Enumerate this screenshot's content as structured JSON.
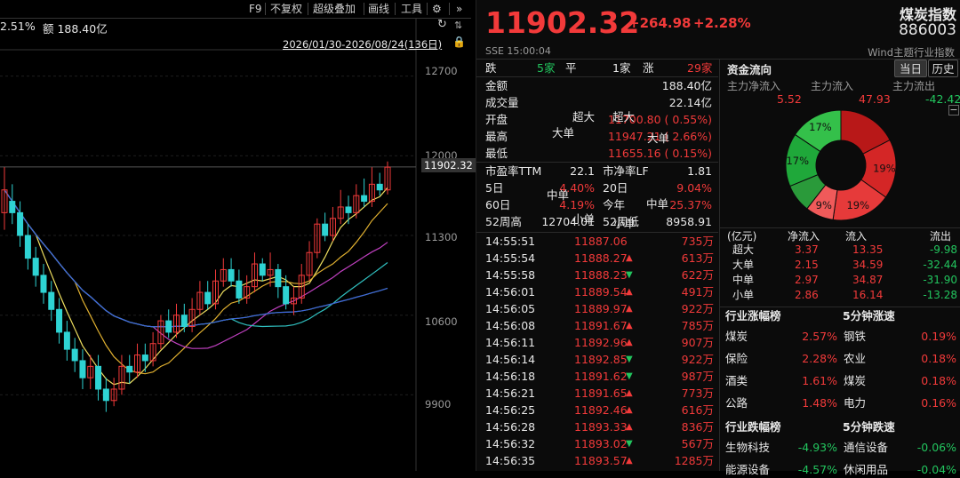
{
  "toolbar": {
    "f9": "F9",
    "no_adjust": "不复权",
    "overlay": "超级叠加",
    "draw": "画线",
    "tools": "工具",
    "expand": "»"
  },
  "chart_header": {
    "pct": "2.51%",
    "amount": "额 188.40亿",
    "range": "2026/01/30-2026/08/24(136日)"
  },
  "price_axis": {
    "labels": [
      "12700",
      "12000",
      "11300",
      "10600",
      "9900"
    ],
    "current": "11902.32"
  },
  "quote": {
    "price": "11902.32",
    "change": "+264.98",
    "change_pct": "+2.28%",
    "name": "煤炭指数",
    "code": "886003",
    "exchange_time": "SSE  15:00:04",
    "source": "Wind主题行业指数"
  },
  "breadth": {
    "down_label": "跌",
    "down": "5家",
    "flat_label": "平",
    "flat": "1家",
    "up_label": "涨",
    "up": "29家"
  },
  "stats": [
    {
      "label": "金额",
      "value": "188.40亿",
      "color": "white"
    },
    {
      "label": "成交量",
      "value": "22.14亿",
      "color": "white"
    },
    {
      "label": "开盘",
      "value": "11700.80 ( 0.55%)",
      "color": "red"
    },
    {
      "label": "最高",
      "value": "11947.21 ( 2.66%)",
      "color": "red"
    },
    {
      "label": "最低",
      "value": "11655.16 ( 0.15%)",
      "color": "red"
    }
  ],
  "metrics": [
    {
      "l1": "市盈率TTM",
      "v1": "22.1",
      "c1": "white",
      "l2": "市净率LF",
      "v2": "1.81",
      "c2": "white"
    },
    {
      "l1": "5日",
      "v1": "4.40%",
      "c1": "red",
      "l2": "20日",
      "v2": "9.04%",
      "c2": "red"
    },
    {
      "l1": "60日",
      "v1": "4.19%",
      "c1": "red",
      "l2": "今年",
      "v2": "25.37%",
      "c2": "red"
    },
    {
      "l1": "52周高",
      "v1": "12704.01",
      "c1": "white",
      "l2": "52周低",
      "v2": "8958.91",
      "c2": "white"
    }
  ],
  "ticks": [
    {
      "time": "14:55:51",
      "price": "11887.06",
      "dir": "",
      "vol": "735万"
    },
    {
      "time": "14:55:54",
      "price": "11888.27",
      "dir": "up",
      "vol": "613万"
    },
    {
      "time": "14:55:58",
      "price": "11888.23",
      "dir": "down",
      "vol": "622万"
    },
    {
      "time": "14:56:01",
      "price": "11889.54",
      "dir": "up",
      "vol": "491万"
    },
    {
      "time": "14:56:05",
      "price": "11889.97",
      "dir": "up",
      "vol": "922万"
    },
    {
      "time": "14:56:08",
      "price": "11891.67",
      "dir": "up",
      "vol": "785万"
    },
    {
      "time": "14:56:11",
      "price": "11892.96",
      "dir": "up",
      "vol": "907万"
    },
    {
      "time": "14:56:14",
      "price": "11892.85",
      "dir": "down",
      "vol": "922万"
    },
    {
      "time": "14:56:18",
      "price": "11891.62",
      "dir": "down",
      "vol": "987万"
    },
    {
      "time": "14:56:21",
      "price": "11891.65",
      "dir": "up",
      "vol": "773万"
    },
    {
      "time": "14:56:25",
      "price": "11892.46",
      "dir": "up",
      "vol": "616万"
    },
    {
      "time": "14:56:28",
      "price": "11893.33",
      "dir": "up",
      "vol": "836万"
    },
    {
      "time": "14:56:32",
      "price": "11893.02",
      "dir": "down",
      "vol": "567万"
    },
    {
      "time": "14:56:35",
      "price": "11893.57",
      "dir": "up",
      "vol": "1285万"
    }
  ],
  "fund_flow": {
    "title": "资金流向",
    "tab_today": "当日",
    "tab_history": "历史",
    "main_net_label": "主力净流入",
    "main_in_label": "主力流入",
    "main_out_label": "主力流出",
    "main_net": "5.52",
    "main_in": "47.93",
    "main_out": "-42.42",
    "donut": [
      {
        "name": "超大",
        "value": 19,
        "color": "#b81818",
        "label": ""
      },
      {
        "name": "大单",
        "value": 19,
        "color": "#d42626",
        "label": "19%"
      },
      {
        "name": "中单",
        "value": 19,
        "color": "#e63a3a",
        "label": "19%"
      },
      {
        "name": "小单",
        "value": 9,
        "color": "#f05a5a",
        "label": "9%"
      },
      {
        "name": "小单",
        "value": 9,
        "color": "#2a9a3a",
        "label": ""
      },
      {
        "name": "中单",
        "value": 17,
        "color": "#1fa83a",
        "label": "17%"
      },
      {
        "name": "大单",
        "value": 17,
        "color": "#34c04a",
        "label": "17%"
      }
    ],
    "donut_labels": [
      "超大",
      "超大",
      "大单",
      "大单",
      "中单",
      "中单",
      "小单",
      "小单"
    ],
    "table_head": [
      "(亿元)",
      "净流入",
      "流入",
      "流出"
    ],
    "table": [
      {
        "name": "超大",
        "net": "3.37",
        "in": "13.35",
        "out": "-9.98"
      },
      {
        "name": "大单",
        "net": "2.15",
        "in": "34.59",
        "out": "-32.44"
      },
      {
        "name": "中单",
        "net": "2.97",
        "in": "34.87",
        "out": "-31.90"
      },
      {
        "name": "小单",
        "net": "2.86",
        "in": "16.14",
        "out": "-13.28"
      }
    ]
  },
  "rankings": {
    "gain_title": "行业涨幅榜",
    "speed_up_title": "5分钟涨速",
    "gains": [
      {
        "n": "煤炭",
        "v": "2.57%"
      },
      {
        "n": "保险",
        "v": "2.28%"
      },
      {
        "n": "酒类",
        "v": "1.61%"
      },
      {
        "n": "公路",
        "v": "1.48%"
      }
    ],
    "speed_up": [
      {
        "n": "钢铁",
        "v": "0.19%"
      },
      {
        "n": "农业",
        "v": "0.18%"
      },
      {
        "n": "煤炭",
        "v": "0.18%"
      },
      {
        "n": "电力",
        "v": "0.16%"
      }
    ],
    "loss_title": "行业跌幅榜",
    "speed_dn_title": "5分钟跌速",
    "losses": [
      {
        "n": "生物科技",
        "v": "-4.93%"
      },
      {
        "n": "能源设备",
        "v": "-4.57%"
      }
    ],
    "speed_dn": [
      {
        "n": "通信设备",
        "v": "-0.06%"
      },
      {
        "n": "休闲用品",
        "v": "-0.04%"
      }
    ]
  },
  "chart_data": {
    "type": "candlestick",
    "ylim": [
      9700,
      12900
    ],
    "yticks": [
      12700,
      12000,
      11300,
      10600,
      9900
    ],
    "candles": [
      [
        11500,
        11700,
        11900,
        11350
      ],
      [
        11600,
        11500,
        11750,
        11400
      ],
      [
        11500,
        11300,
        11600,
        11200
      ],
      [
        11300,
        11100,
        11400,
        11000
      ],
      [
        11100,
        10950,
        11200,
        10850
      ],
      [
        10950,
        10800,
        11050,
        10700
      ],
      [
        10800,
        10650,
        10900,
        10550
      ],
      [
        10650,
        10450,
        10750,
        10350
      ],
      [
        10450,
        10300,
        10550,
        10200
      ],
      [
        10300,
        10200,
        10400,
        10100
      ],
      [
        10200,
        10050,
        10300,
        9950
      ],
      [
        10050,
        10150,
        10250,
        9950
      ],
      [
        10150,
        9950,
        10250,
        9850
      ],
      [
        9950,
        9850,
        10050,
        9750
      ],
      [
        9850,
        9950,
        10050,
        9800
      ],
      [
        9950,
        10150,
        10250,
        9900
      ],
      [
        10150,
        10100,
        10250,
        10000
      ],
      [
        10100,
        10250,
        10350,
        10050
      ],
      [
        10250,
        10200,
        10350,
        10100
      ],
      [
        10200,
        10350,
        10450,
        10150
      ],
      [
        10350,
        10550,
        10600,
        10300
      ],
      [
        10550,
        10450,
        10650,
        10400
      ],
      [
        10450,
        10600,
        10700,
        10400
      ],
      [
        10600,
        10500,
        10700,
        10450
      ],
      [
        10500,
        10650,
        10750,
        10450
      ],
      [
        10650,
        10800,
        10900,
        10600
      ],
      [
        10800,
        10700,
        10900,
        10650
      ],
      [
        10700,
        10900,
        11000,
        10650
      ],
      [
        10900,
        11000,
        11100,
        10850
      ],
      [
        11000,
        10900,
        11100,
        10850
      ],
      [
        10900,
        10750,
        11000,
        10700
      ],
      [
        10750,
        10850,
        10950,
        10700
      ],
      [
        10850,
        11050,
        11150,
        10800
      ],
      [
        11050,
        10950,
        11100,
        10900
      ],
      [
        10950,
        11000,
        11150,
        10850
      ],
      [
        11000,
        10850,
        11050,
        10750
      ],
      [
        10850,
        10700,
        10950,
        10650
      ],
      [
        10700,
        10750,
        10850,
        10600
      ],
      [
        10750,
        10950,
        11050,
        10700
      ],
      [
        10950,
        11150,
        11250,
        10900
      ],
      [
        11150,
        11400,
        11450,
        11100
      ],
      [
        11400,
        11300,
        11500,
        11250
      ],
      [
        11300,
        11450,
        11550,
        11250
      ],
      [
        11450,
        11550,
        11700,
        11400
      ],
      [
        11550,
        11500,
        11650,
        11400
      ],
      [
        11500,
        11650,
        11750,
        11450
      ],
      [
        11650,
        11600,
        11800,
        11550
      ],
      [
        11600,
        11750,
        11900,
        11550
      ],
      [
        11750,
        11700,
        11850,
        11650
      ],
      [
        11700,
        11900,
        11950,
        11660
      ]
    ]
  }
}
